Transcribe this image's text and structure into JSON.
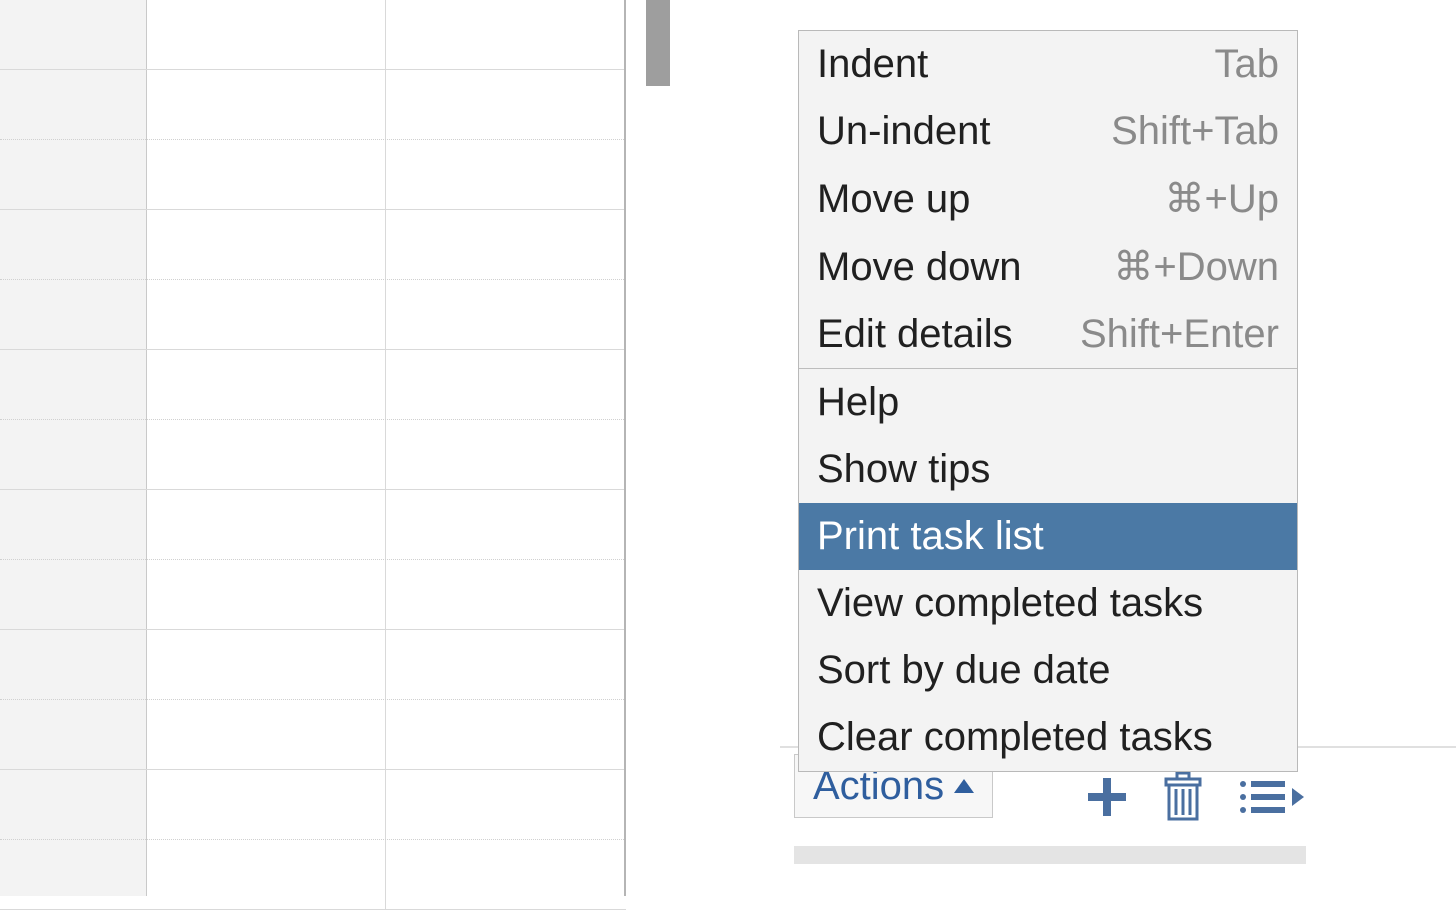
{
  "menu": {
    "group1": [
      {
        "label": "Indent",
        "shortcut": "Tab"
      },
      {
        "label": "Un-indent",
        "shortcut": "Shift+Tab"
      },
      {
        "label": "Move up",
        "shortcut": "⌘+Up"
      },
      {
        "label": "Move down",
        "shortcut": "⌘+Down"
      },
      {
        "label": "Edit details",
        "shortcut": "Shift+Enter"
      }
    ],
    "group2": [
      {
        "label": "Help"
      },
      {
        "label": "Show tips"
      },
      {
        "label": "Print task list",
        "selected": true
      },
      {
        "label": "View completed tasks"
      },
      {
        "label": "Sort by due date"
      },
      {
        "label": "Clear completed tasks"
      }
    ]
  },
  "footer": {
    "actions_label": "Actions"
  }
}
